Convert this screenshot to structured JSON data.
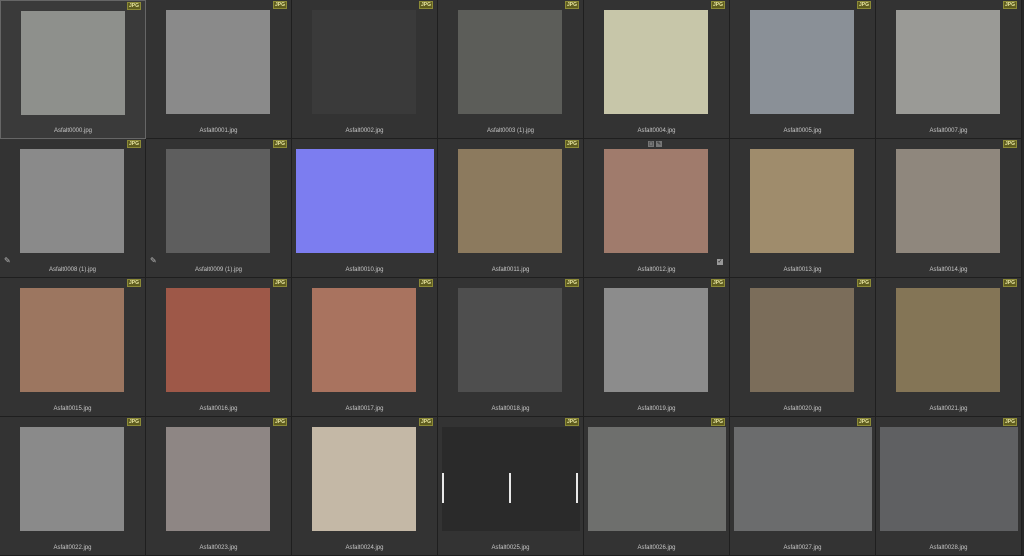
{
  "badge_text": "JPG",
  "items": [
    {
      "label": "Asfalt0000.jpg",
      "color": "#8e908c",
      "selected": true
    },
    {
      "label": "Asfalt0001.jpg",
      "color": "#8a8a8a"
    },
    {
      "label": "Asfalt0002.jpg",
      "color": "#3a3a3a"
    },
    {
      "label": "Asfalt0003 (1).jpg",
      "color": "#5c5d59"
    },
    {
      "label": "Asfalt0004.jpg",
      "color": "#c7c6a9"
    },
    {
      "label": "Asfalt0005.jpg",
      "color": "#8a9097"
    },
    {
      "label": "Asfalt0007.jpg",
      "color": "#9a9a96"
    },
    {
      "label": "Asfalt0008 (1).jpg",
      "color": "#8a8a8a",
      "pencil": true
    },
    {
      "label": "Asfalt0009 (1).jpg",
      "color": "#5e5e5e",
      "pencil": true
    },
    {
      "label": "Asfalt0010.jpg",
      "color": "#7c7df0",
      "wide": true,
      "no_badge": true
    },
    {
      "label": "Asfalt0011.jpg",
      "color": "#8c7a5e"
    },
    {
      "label": "Asfalt0012.jpg",
      "color": "#a07b6c",
      "tools": true,
      "check": true,
      "no_badge": true
    },
    {
      "label": "Asfalt0013.jpg",
      "color": "#9f8c6c",
      "no_badge": true
    },
    {
      "label": "Asfalt0014.jpg",
      "color": "#8f877d"
    },
    {
      "label": "Asfalt0015.jpg",
      "color": "#9c7660"
    },
    {
      "label": "Asfalt0016.jpg",
      "color": "#9e5848"
    },
    {
      "label": "Asfalt0017.jpg",
      "color": "#a9735f"
    },
    {
      "label": "Asfalt0018.jpg",
      "color": "#4e4e4e"
    },
    {
      "label": "Asfalt0019.jpg",
      "color": "#8c8c8c"
    },
    {
      "label": "Asfalt0020.jpg",
      "color": "#7b6d5a"
    },
    {
      "label": "Asfalt0021.jpg",
      "color": "#847556"
    },
    {
      "label": "Asfalt0022.jpg",
      "color": "#8a8a8a"
    },
    {
      "label": "Asfalt0023.jpg",
      "color": "#8e8684"
    },
    {
      "label": "Asfalt0024.jpg",
      "color": "#c4b8a6"
    },
    {
      "label": "Asfalt0025.jpg",
      "color": "#2a2a2a",
      "road": true,
      "wide": true
    },
    {
      "label": "Asfalt0026.jpg",
      "color": "#6e6f6d",
      "wide": true
    },
    {
      "label": "Asfalt0027.jpg",
      "color": "#6b6c6d",
      "wide": true
    },
    {
      "label": "Asfalt0028.jpg",
      "color": "#5f6062",
      "wide": true
    }
  ]
}
